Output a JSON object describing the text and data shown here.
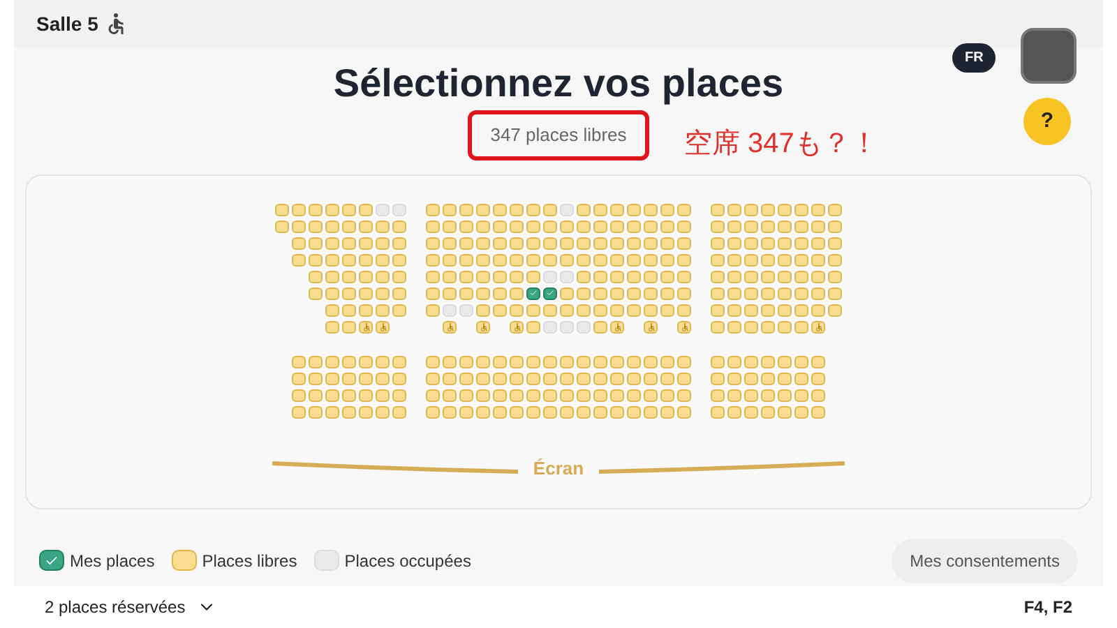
{
  "header": {
    "room": "Salle 5"
  },
  "language": "FR",
  "help": "?",
  "title": "Sélectionnez vos places",
  "free_count": "347 places libres",
  "annotation": "空席 347も？！",
  "sections": [
    {
      "blocks": [
        {
          "rows": [
            {
              "seats": [
                {
                  "kind": "free"
                },
                {
                  "kind": "free"
                },
                {
                  "kind": "free"
                },
                {
                  "kind": "free"
                },
                {
                  "kind": "free"
                },
                {
                  "kind": "free"
                },
                {
                  "kind": "taken"
                },
                {
                  "kind": "taken"
                }
              ]
            },
            {
              "seats": [
                {
                  "kind": "free"
                },
                {
                  "kind": "free"
                },
                {
                  "kind": "free"
                },
                {
                  "kind": "free"
                },
                {
                  "kind": "free"
                },
                {
                  "kind": "free"
                },
                {
                  "kind": "free"
                },
                {
                  "kind": "free"
                }
              ]
            },
            {
              "seats": [
                {
                  "kind": "gap"
                },
                {
                  "kind": "free"
                },
                {
                  "kind": "free"
                },
                {
                  "kind": "free"
                },
                {
                  "kind": "free"
                },
                {
                  "kind": "free"
                },
                {
                  "kind": "free"
                },
                {
                  "kind": "free"
                }
              ]
            },
            {
              "seats": [
                {
                  "kind": "gap"
                },
                {
                  "kind": "free"
                },
                {
                  "kind": "free"
                },
                {
                  "kind": "free"
                },
                {
                  "kind": "free"
                },
                {
                  "kind": "free"
                },
                {
                  "kind": "free"
                },
                {
                  "kind": "free"
                }
              ]
            },
            {
              "seats": [
                {
                  "kind": "gap"
                },
                {
                  "kind": "gap"
                },
                {
                  "kind": "free"
                },
                {
                  "kind": "free"
                },
                {
                  "kind": "free"
                },
                {
                  "kind": "free"
                },
                {
                  "kind": "free"
                },
                {
                  "kind": "free"
                }
              ]
            },
            {
              "seats": [
                {
                  "kind": "gap"
                },
                {
                  "kind": "gap"
                },
                {
                  "kind": "free"
                },
                {
                  "kind": "free"
                },
                {
                  "kind": "free"
                },
                {
                  "kind": "free"
                },
                {
                  "kind": "free"
                },
                {
                  "kind": "free"
                }
              ]
            },
            {
              "seats": [
                {
                  "kind": "gap"
                },
                {
                  "kind": "gap"
                },
                {
                  "kind": "gap"
                },
                {
                  "kind": "free"
                },
                {
                  "kind": "free"
                },
                {
                  "kind": "free"
                },
                {
                  "kind": "free"
                },
                {
                  "kind": "free"
                }
              ]
            },
            {
              "seats": [
                {
                  "kind": "gap"
                },
                {
                  "kind": "gap"
                },
                {
                  "kind": "gap"
                },
                {
                  "kind": "free"
                },
                {
                  "kind": "free"
                },
                {
                  "kind": "wheelchair"
                },
                {
                  "kind": "wheelchair"
                },
                {
                  "kind": "gap"
                }
              ]
            }
          ]
        },
        {
          "rows": [
            {
              "seats": [
                {
                  "kind": "free"
                },
                {
                  "kind": "free"
                },
                {
                  "kind": "free"
                },
                {
                  "kind": "free"
                },
                {
                  "kind": "free"
                },
                {
                  "kind": "free"
                },
                {
                  "kind": "free"
                },
                {
                  "kind": "free"
                },
                {
                  "kind": "taken"
                },
                {
                  "kind": "free"
                },
                {
                  "kind": "free"
                },
                {
                  "kind": "free"
                },
                {
                  "kind": "free"
                },
                {
                  "kind": "free"
                },
                {
                  "kind": "free"
                },
                {
                  "kind": "free"
                }
              ]
            },
            {
              "seats": [
                {
                  "kind": "free"
                },
                {
                  "kind": "free"
                },
                {
                  "kind": "free"
                },
                {
                  "kind": "free"
                },
                {
                  "kind": "free"
                },
                {
                  "kind": "free"
                },
                {
                  "kind": "free"
                },
                {
                  "kind": "free"
                },
                {
                  "kind": "free"
                },
                {
                  "kind": "free"
                },
                {
                  "kind": "free"
                },
                {
                  "kind": "free"
                },
                {
                  "kind": "free"
                },
                {
                  "kind": "free"
                },
                {
                  "kind": "free"
                },
                {
                  "kind": "free"
                }
              ]
            },
            {
              "seats": [
                {
                  "kind": "free"
                },
                {
                  "kind": "free"
                },
                {
                  "kind": "free"
                },
                {
                  "kind": "free"
                },
                {
                  "kind": "free"
                },
                {
                  "kind": "free"
                },
                {
                  "kind": "free"
                },
                {
                  "kind": "free"
                },
                {
                  "kind": "free"
                },
                {
                  "kind": "free"
                },
                {
                  "kind": "free"
                },
                {
                  "kind": "free"
                },
                {
                  "kind": "free"
                },
                {
                  "kind": "free"
                },
                {
                  "kind": "free"
                },
                {
                  "kind": "free"
                }
              ]
            },
            {
              "seats": [
                {
                  "kind": "free"
                },
                {
                  "kind": "free"
                },
                {
                  "kind": "free"
                },
                {
                  "kind": "free"
                },
                {
                  "kind": "free"
                },
                {
                  "kind": "free"
                },
                {
                  "kind": "free"
                },
                {
                  "kind": "free"
                },
                {
                  "kind": "free"
                },
                {
                  "kind": "free"
                },
                {
                  "kind": "free"
                },
                {
                  "kind": "free"
                },
                {
                  "kind": "free"
                },
                {
                  "kind": "free"
                },
                {
                  "kind": "free"
                },
                {
                  "kind": "free"
                }
              ]
            },
            {
              "seats": [
                {
                  "kind": "free"
                },
                {
                  "kind": "free"
                },
                {
                  "kind": "free"
                },
                {
                  "kind": "free"
                },
                {
                  "kind": "free"
                },
                {
                  "kind": "free"
                },
                {
                  "kind": "free"
                },
                {
                  "kind": "taken"
                },
                {
                  "kind": "taken"
                },
                {
                  "kind": "free"
                },
                {
                  "kind": "free"
                },
                {
                  "kind": "free"
                },
                {
                  "kind": "free"
                },
                {
                  "kind": "free"
                },
                {
                  "kind": "free"
                },
                {
                  "kind": "free"
                }
              ]
            },
            {
              "seats": [
                {
                  "kind": "free"
                },
                {
                  "kind": "free"
                },
                {
                  "kind": "free"
                },
                {
                  "kind": "free"
                },
                {
                  "kind": "free"
                },
                {
                  "kind": "free"
                },
                {
                  "kind": "mine"
                },
                {
                  "kind": "mine"
                },
                {
                  "kind": "free"
                },
                {
                  "kind": "free"
                },
                {
                  "kind": "free"
                },
                {
                  "kind": "free"
                },
                {
                  "kind": "free"
                },
                {
                  "kind": "free"
                },
                {
                  "kind": "free"
                },
                {
                  "kind": "free"
                }
              ]
            },
            {
              "seats": [
                {
                  "kind": "free"
                },
                {
                  "kind": "taken"
                },
                {
                  "kind": "taken"
                },
                {
                  "kind": "free"
                },
                {
                  "kind": "free"
                },
                {
                  "kind": "free"
                },
                {
                  "kind": "free"
                },
                {
                  "kind": "free"
                },
                {
                  "kind": "free"
                },
                {
                  "kind": "free"
                },
                {
                  "kind": "free"
                },
                {
                  "kind": "free"
                },
                {
                  "kind": "free"
                },
                {
                  "kind": "free"
                },
                {
                  "kind": "free"
                },
                {
                  "kind": "free"
                }
              ]
            },
            {
              "seats": [
                {
                  "kind": "gap"
                },
                {
                  "kind": "wheelchair"
                },
                {
                  "kind": "gap"
                },
                {
                  "kind": "wheelchair"
                },
                {
                  "kind": "gap"
                },
                {
                  "kind": "wheelchair"
                },
                {
                  "kind": "free"
                },
                {
                  "kind": "taken"
                },
                {
                  "kind": "taken"
                },
                {
                  "kind": "taken"
                },
                {
                  "kind": "free"
                },
                {
                  "kind": "wheelchair"
                },
                {
                  "kind": "gap"
                },
                {
                  "kind": "wheelchair"
                },
                {
                  "kind": "gap"
                },
                {
                  "kind": "wheelchair"
                }
              ]
            }
          ]
        },
        {
          "rows": [
            {
              "seats": [
                {
                  "kind": "free"
                },
                {
                  "kind": "free"
                },
                {
                  "kind": "free"
                },
                {
                  "kind": "free"
                },
                {
                  "kind": "free"
                },
                {
                  "kind": "free"
                },
                {
                  "kind": "free"
                },
                {
                  "kind": "free"
                }
              ]
            },
            {
              "seats": [
                {
                  "kind": "free"
                },
                {
                  "kind": "free"
                },
                {
                  "kind": "free"
                },
                {
                  "kind": "free"
                },
                {
                  "kind": "free"
                },
                {
                  "kind": "free"
                },
                {
                  "kind": "free"
                },
                {
                  "kind": "free"
                }
              ]
            },
            {
              "seats": [
                {
                  "kind": "free"
                },
                {
                  "kind": "free"
                },
                {
                  "kind": "free"
                },
                {
                  "kind": "free"
                },
                {
                  "kind": "free"
                },
                {
                  "kind": "free"
                },
                {
                  "kind": "free"
                },
                {
                  "kind": "free"
                }
              ]
            },
            {
              "seats": [
                {
                  "kind": "free"
                },
                {
                  "kind": "free"
                },
                {
                  "kind": "free"
                },
                {
                  "kind": "free"
                },
                {
                  "kind": "free"
                },
                {
                  "kind": "free"
                },
                {
                  "kind": "free"
                },
                {
                  "kind": "free"
                }
              ]
            },
            {
              "seats": [
                {
                  "kind": "free"
                },
                {
                  "kind": "free"
                },
                {
                  "kind": "free"
                },
                {
                  "kind": "free"
                },
                {
                  "kind": "free"
                },
                {
                  "kind": "free"
                },
                {
                  "kind": "free"
                },
                {
                  "kind": "free"
                }
              ]
            },
            {
              "seats": [
                {
                  "kind": "free"
                },
                {
                  "kind": "free"
                },
                {
                  "kind": "free"
                },
                {
                  "kind": "free"
                },
                {
                  "kind": "free"
                },
                {
                  "kind": "free"
                },
                {
                  "kind": "free"
                },
                {
                  "kind": "free"
                }
              ]
            },
            {
              "seats": [
                {
                  "kind": "free"
                },
                {
                  "kind": "free"
                },
                {
                  "kind": "free"
                },
                {
                  "kind": "free"
                },
                {
                  "kind": "free"
                },
                {
                  "kind": "free"
                },
                {
                  "kind": "free"
                },
                {
                  "kind": "free"
                }
              ]
            },
            {
              "seats": [
                {
                  "kind": "free"
                },
                {
                  "kind": "free"
                },
                {
                  "kind": "free"
                },
                {
                  "kind": "free"
                },
                {
                  "kind": "free"
                },
                {
                  "kind": "free"
                },
                {
                  "kind": "wheelchair"
                },
                {
                  "kind": "gap"
                }
              ]
            }
          ]
        }
      ]
    },
    {
      "blocks": [
        {
          "rows": [
            {
              "seats": [
                {
                  "kind": "gap"
                },
                {
                  "kind": "free"
                },
                {
                  "kind": "free"
                },
                {
                  "kind": "free"
                },
                {
                  "kind": "free"
                },
                {
                  "kind": "free"
                },
                {
                  "kind": "free"
                },
                {
                  "kind": "free"
                }
              ]
            },
            {
              "seats": [
                {
                  "kind": "gap"
                },
                {
                  "kind": "free"
                },
                {
                  "kind": "free"
                },
                {
                  "kind": "free"
                },
                {
                  "kind": "free"
                },
                {
                  "kind": "free"
                },
                {
                  "kind": "free"
                },
                {
                  "kind": "free"
                }
              ]
            },
            {
              "seats": [
                {
                  "kind": "gap"
                },
                {
                  "kind": "free"
                },
                {
                  "kind": "free"
                },
                {
                  "kind": "free"
                },
                {
                  "kind": "free"
                },
                {
                  "kind": "free"
                },
                {
                  "kind": "free"
                },
                {
                  "kind": "free"
                }
              ]
            },
            {
              "seats": [
                {
                  "kind": "gap"
                },
                {
                  "kind": "free"
                },
                {
                  "kind": "free"
                },
                {
                  "kind": "free"
                },
                {
                  "kind": "free"
                },
                {
                  "kind": "free"
                },
                {
                  "kind": "free"
                },
                {
                  "kind": "free"
                }
              ]
            }
          ]
        },
        {
          "rows": [
            {
              "seats": [
                {
                  "kind": "free"
                },
                {
                  "kind": "free"
                },
                {
                  "kind": "free"
                },
                {
                  "kind": "free"
                },
                {
                  "kind": "free"
                },
                {
                  "kind": "free"
                },
                {
                  "kind": "free"
                },
                {
                  "kind": "free"
                },
                {
                  "kind": "free"
                },
                {
                  "kind": "free"
                },
                {
                  "kind": "free"
                },
                {
                  "kind": "free"
                },
                {
                  "kind": "free"
                },
                {
                  "kind": "free"
                },
                {
                  "kind": "free"
                },
                {
                  "kind": "free"
                }
              ]
            },
            {
              "seats": [
                {
                  "kind": "free"
                },
                {
                  "kind": "free"
                },
                {
                  "kind": "free"
                },
                {
                  "kind": "free"
                },
                {
                  "kind": "free"
                },
                {
                  "kind": "free"
                },
                {
                  "kind": "free"
                },
                {
                  "kind": "free"
                },
                {
                  "kind": "free"
                },
                {
                  "kind": "free"
                },
                {
                  "kind": "free"
                },
                {
                  "kind": "free"
                },
                {
                  "kind": "free"
                },
                {
                  "kind": "free"
                },
                {
                  "kind": "free"
                },
                {
                  "kind": "free"
                }
              ]
            },
            {
              "seats": [
                {
                  "kind": "free"
                },
                {
                  "kind": "free"
                },
                {
                  "kind": "free"
                },
                {
                  "kind": "free"
                },
                {
                  "kind": "free"
                },
                {
                  "kind": "free"
                },
                {
                  "kind": "free"
                },
                {
                  "kind": "free"
                },
                {
                  "kind": "free"
                },
                {
                  "kind": "free"
                },
                {
                  "kind": "free"
                },
                {
                  "kind": "free"
                },
                {
                  "kind": "free"
                },
                {
                  "kind": "free"
                },
                {
                  "kind": "free"
                },
                {
                  "kind": "free"
                }
              ]
            },
            {
              "seats": [
                {
                  "kind": "free"
                },
                {
                  "kind": "free"
                },
                {
                  "kind": "free"
                },
                {
                  "kind": "free"
                },
                {
                  "kind": "free"
                },
                {
                  "kind": "free"
                },
                {
                  "kind": "free"
                },
                {
                  "kind": "free"
                },
                {
                  "kind": "free"
                },
                {
                  "kind": "free"
                },
                {
                  "kind": "free"
                },
                {
                  "kind": "free"
                },
                {
                  "kind": "free"
                },
                {
                  "kind": "free"
                },
                {
                  "kind": "free"
                },
                {
                  "kind": "free"
                }
              ]
            }
          ]
        },
        {
          "rows": [
            {
              "seats": [
                {
                  "kind": "free"
                },
                {
                  "kind": "free"
                },
                {
                  "kind": "free"
                },
                {
                  "kind": "free"
                },
                {
                  "kind": "free"
                },
                {
                  "kind": "free"
                },
                {
                  "kind": "free"
                },
                {
                  "kind": "gap"
                }
              ]
            },
            {
              "seats": [
                {
                  "kind": "free"
                },
                {
                  "kind": "free"
                },
                {
                  "kind": "free"
                },
                {
                  "kind": "free"
                },
                {
                  "kind": "free"
                },
                {
                  "kind": "free"
                },
                {
                  "kind": "free"
                },
                {
                  "kind": "gap"
                }
              ]
            },
            {
              "seats": [
                {
                  "kind": "free"
                },
                {
                  "kind": "free"
                },
                {
                  "kind": "free"
                },
                {
                  "kind": "free"
                },
                {
                  "kind": "free"
                },
                {
                  "kind": "free"
                },
                {
                  "kind": "free"
                },
                {
                  "kind": "gap"
                }
              ]
            },
            {
              "seats": [
                {
                  "kind": "free"
                },
                {
                  "kind": "free"
                },
                {
                  "kind": "free"
                },
                {
                  "kind": "free"
                },
                {
                  "kind": "free"
                },
                {
                  "kind": "free"
                },
                {
                  "kind": "free"
                },
                {
                  "kind": "gap"
                }
              ]
            }
          ]
        }
      ]
    }
  ],
  "screen": "Écran",
  "legend": [
    {
      "kind": "mine",
      "label": "Mes places"
    },
    {
      "kind": "free",
      "label": "Places libres"
    },
    {
      "kind": "taken",
      "label": "Places occupées"
    }
  ],
  "consent_button": "Mes consentements",
  "footer": {
    "reserved": "2 places réservées",
    "seats": "F4, F2"
  }
}
